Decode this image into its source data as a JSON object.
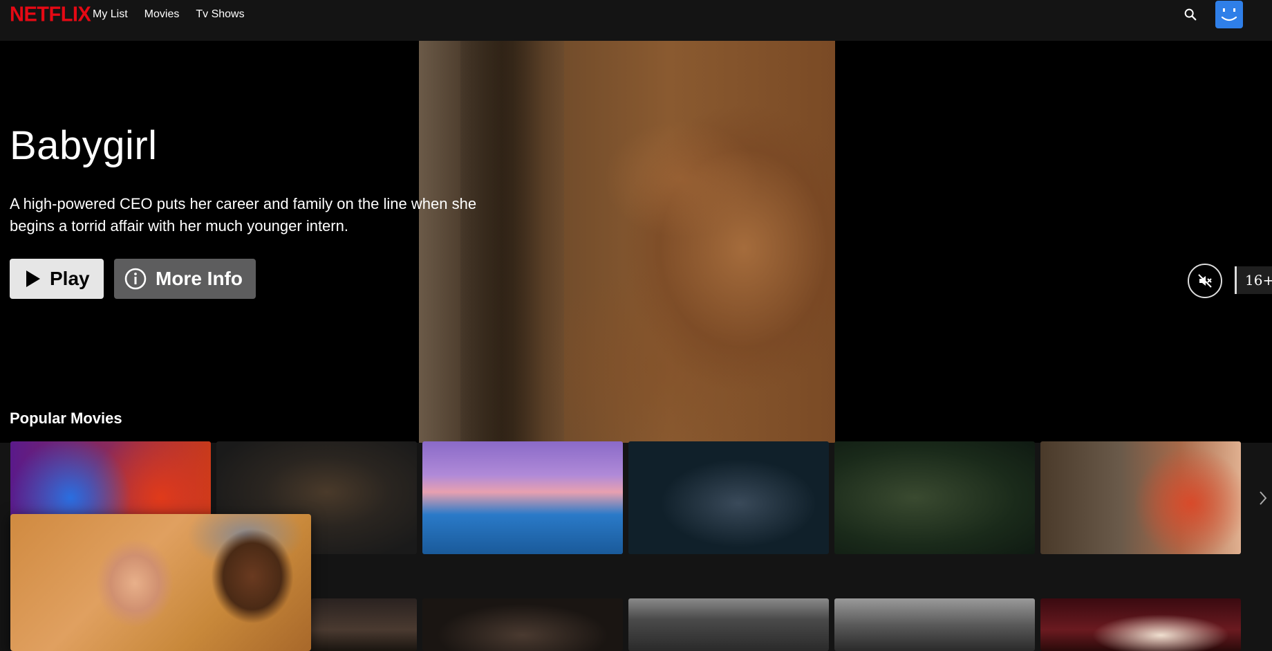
{
  "header": {
    "logo": "NETFLIX",
    "nav": [
      "My List",
      "Movies",
      "Tv Shows"
    ],
    "search_icon": "search-icon",
    "avatar_icon": "smiley-avatar-icon"
  },
  "hero": {
    "title": "Babygirl",
    "description": "A high-powered CEO puts her career and family on the line when she begins a torrid affair with her much younger intern.",
    "play_label": "Play",
    "info_label": "More Info",
    "maturity_rating": "16+",
    "mute_icon": "volume-off-icon"
  },
  "rows": [
    {
      "title": "Popular Movies",
      "tiles": [
        "sonic-tile",
        "kraven-tile",
        "moana-tile",
        "back-in-action-tile",
        "armor-tile",
        "soldier-tile"
      ]
    },
    {
      "title": "",
      "tiles": [
        "shawshank-hover-card",
        "godfather-tile",
        "godfather-2-tile",
        "crowd-bw-tile",
        "twelve-angry-men-tile",
        "spirited-away-tile"
      ]
    }
  ],
  "colors": {
    "brand": "#e50914",
    "background": "#141414",
    "avatar": "#2f7fe8"
  }
}
